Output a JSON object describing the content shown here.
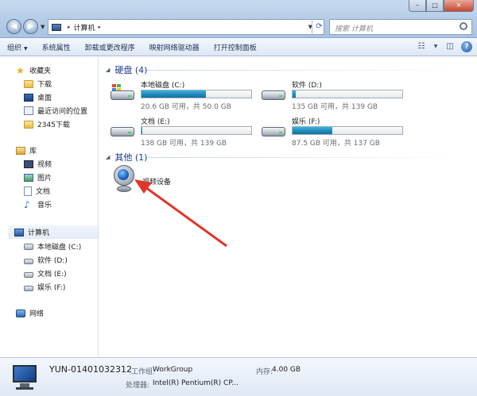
{
  "window": {
    "buttons": [
      "–",
      "□",
      "✕"
    ]
  },
  "address": {
    "separator": "▸",
    "path": "计算机",
    "trailing_sep": "▸"
  },
  "search": {
    "placeholder": "搜索 计算机"
  },
  "toolbar": {
    "organize": "组织",
    "system_properties": "系统属性",
    "uninstall": "卸载或更改程序",
    "map_drive": "映射网络驱动器",
    "control_panel": "打开控制面板"
  },
  "nav": {
    "favorites": "收藏夹",
    "downloads": "下载",
    "desktop": "桌面",
    "recent": "最近访问的位置",
    "downloads2345": "2345下载",
    "libraries": "库",
    "videos": "视频",
    "pictures": "图片",
    "documents": "文档",
    "music": "音乐",
    "computer": "计算机",
    "drive_c": "本地磁盘 (C:)",
    "drive_d": "软件 (D:)",
    "drive_e": "文档 (E:)",
    "drive_f": "娱乐 (F:)",
    "network": "网络"
  },
  "content": {
    "hdd_header": "硬盘 (4)",
    "other_header": "其他 (1)",
    "drives": [
      {
        "name": "本地磁盘 (C:)",
        "info": "20.6 GB 可用，共 50.0 GB",
        "used_fraction": 0.59
      },
      {
        "name": "软件 (D:)",
        "info": "135 GB 可用，共 139 GB",
        "used_fraction": 0.03
      },
      {
        "name": "文档 (E:)",
        "info": "138 GB 可用，共 139 GB",
        "used_fraction": 0.01
      },
      {
        "name": "娱乐 (F:)",
        "info": "87.5 GB 可用，共 137 GB",
        "used_fraction": 0.36
      }
    ],
    "camera_label": "视频设备"
  },
  "details": {
    "computer_name": "YUN-01401032312",
    "workgroup_label": "工作组:",
    "workgroup_value": "WorkGroup",
    "memory_label": "内存:",
    "memory_value": "4.00 GB",
    "processor_label": "处理器:",
    "processor_value": "Intel(R) Pentium(R) CP..."
  },
  "colors": {
    "accent": "#1e3a8a",
    "bar_fill": "#1f86b8",
    "arrow": "#e0352b"
  }
}
